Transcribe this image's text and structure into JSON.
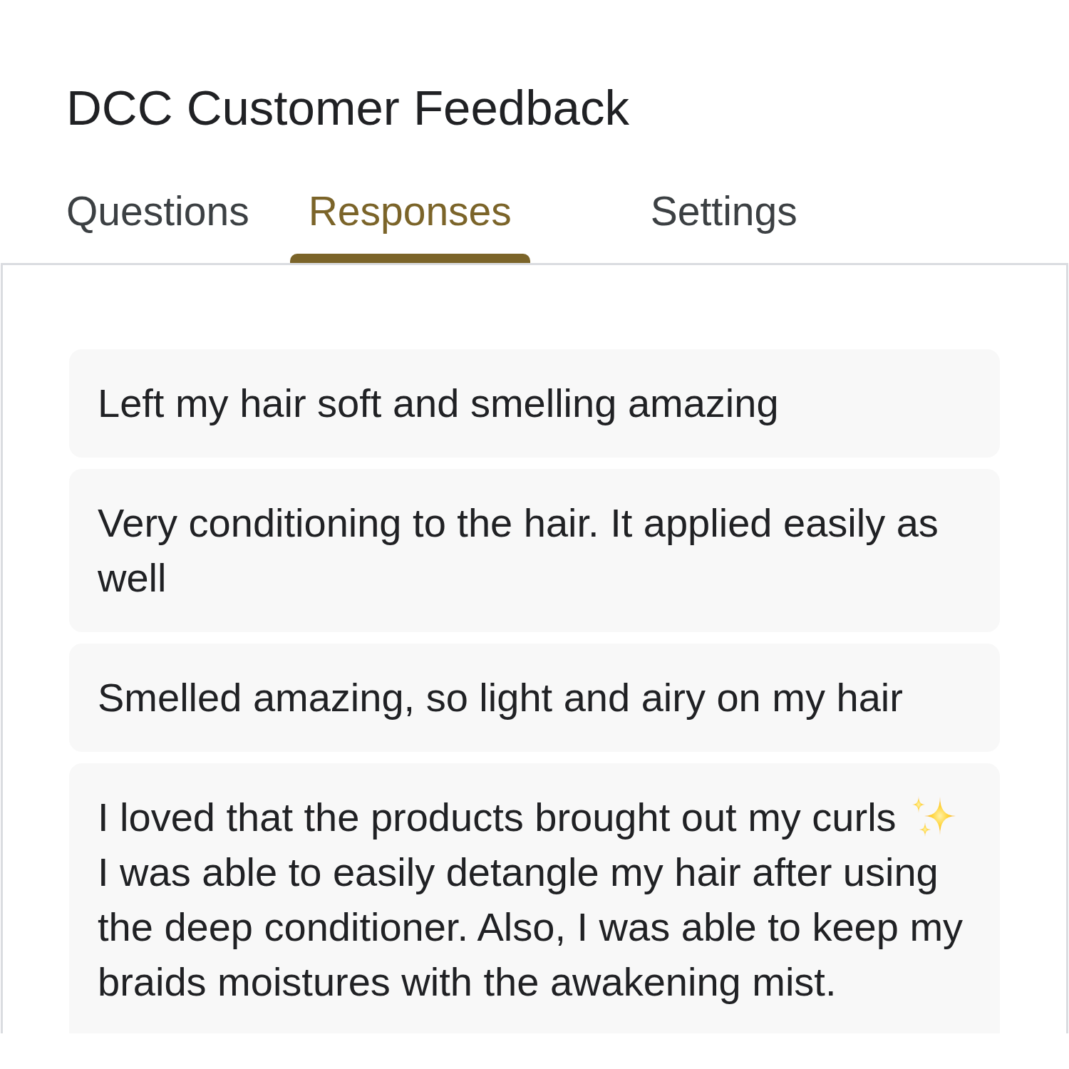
{
  "form": {
    "title": "DCC Customer Feedback"
  },
  "tabs": [
    {
      "label": "Questions",
      "selected": false
    },
    {
      "label": "Responses",
      "selected": true
    },
    {
      "label": "Settings",
      "selected": false
    }
  ],
  "responses": [
    {
      "paragraphs": [
        {
          "text": "Left my hair soft and smelling amazing"
        }
      ]
    },
    {
      "paragraphs": [
        {
          "text": "Very conditioning to the hair. It applied easily as well"
        }
      ]
    },
    {
      "paragraphs": [
        {
          "text": "Smelled amazing, so light and airy on my hair"
        }
      ]
    },
    {
      "paragraphs": [
        {
          "text": "I loved that the products brought out my curls",
          "trailing_icon": true
        },
        {
          "text": "I was able to easily detangle my hair after using the deep conditioner. Also, I was able to keep my braids moistures with the awakening mist."
        }
      ]
    }
  ]
}
